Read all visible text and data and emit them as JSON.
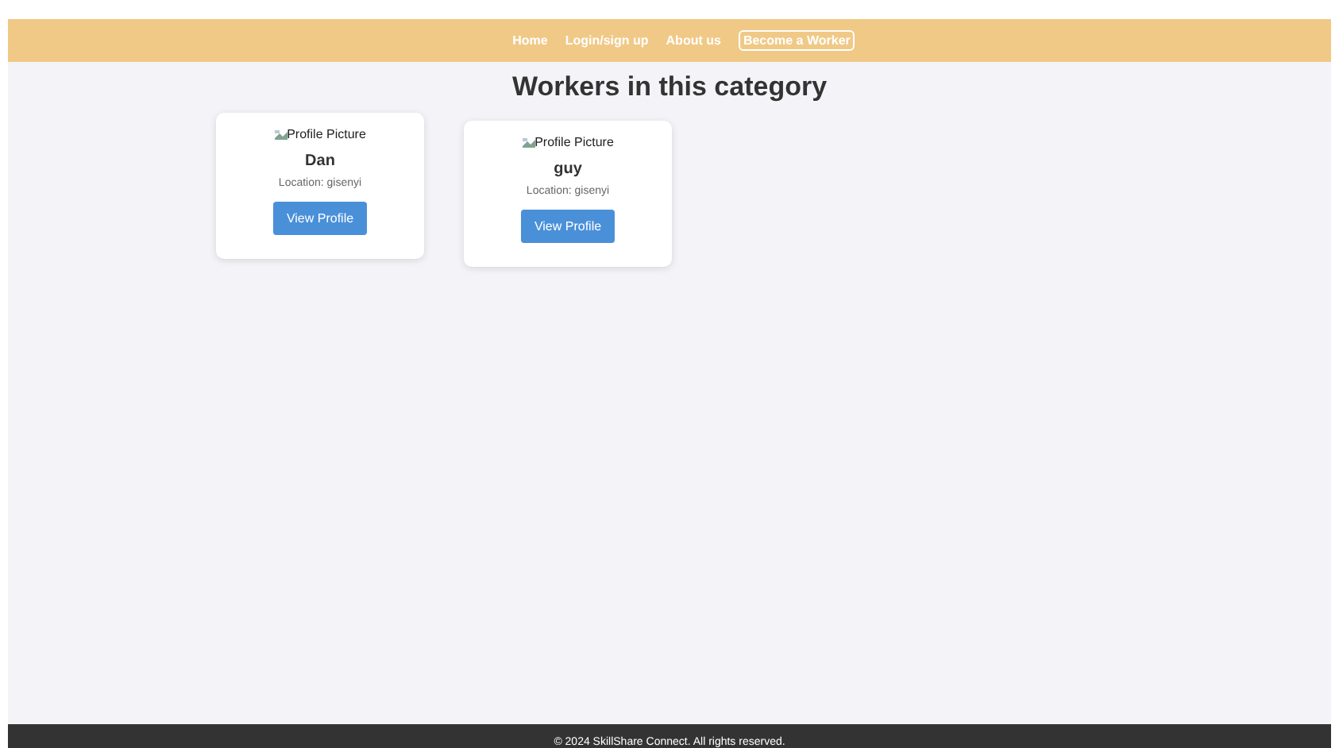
{
  "nav": {
    "links": [
      "Home",
      "Login/sign up",
      "About us"
    ],
    "cta": "Become a Worker"
  },
  "heading": "Workers in this category",
  "workers": [
    {
      "image_alt": "Profile Picture",
      "name": "Dan",
      "location": "Location: gisenyi",
      "button": "View Profile"
    },
    {
      "image_alt": "Profile Picture",
      "name": "guy",
      "location": "Location: gisenyi",
      "button": "View Profile"
    }
  ],
  "footer": "© 2024 SkillShare Connect. All rights reserved."
}
